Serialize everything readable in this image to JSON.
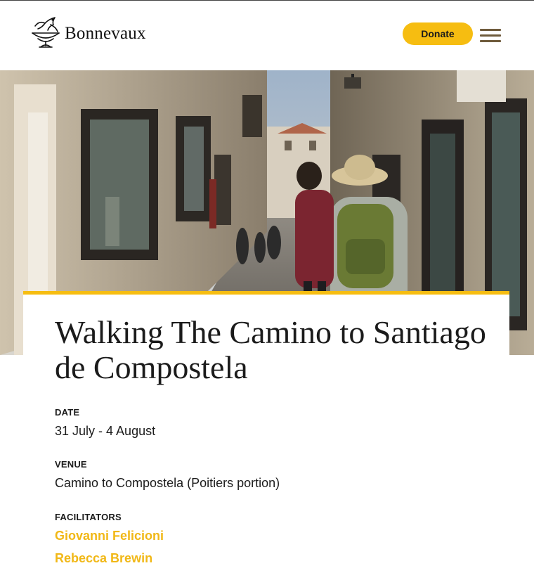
{
  "header": {
    "logo_text": "Bonnevaux",
    "donate_label": "Donate"
  },
  "hero": {
    "image_subject": "pilgrims walking down a narrow stone street"
  },
  "event": {
    "title": "Walking The Camino to Santiago de Compostela",
    "date_label": "DATE",
    "date_value": "31 July - 4 August",
    "venue_label": "VENUE",
    "venue_value": "Camino to Compostela (Poitiers portion)",
    "facilitators_label": "FACILITATORS",
    "facilitators": [
      "Giovanni Felicioni",
      "Rebecca Brewin"
    ]
  },
  "colors": {
    "accent": "#f6bd11",
    "link": "#f1b817",
    "menu_icon": "#6f5b3c",
    "text": "#1b1b1b"
  }
}
